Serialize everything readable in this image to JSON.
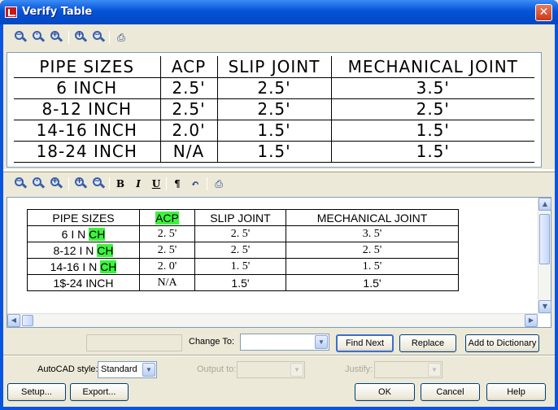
{
  "window": {
    "title": "Verify Table",
    "close_glyph": "✕"
  },
  "toolbar_top": {
    "icons": [
      "zoom-out-icon",
      "zoom-extents-icon",
      "zoom-in-icon",
      "zoom-in-plus-icon",
      "zoom-out-minus-icon",
      "print-icon"
    ]
  },
  "preview_table": {
    "headers": [
      "PIPE SIZES",
      "ACP",
      "SLIP JOINT",
      "MECHANICAL JOINT"
    ],
    "rows": [
      [
        "6 INCH",
        "2.5'",
        "2.5'",
        "3.5'"
      ],
      [
        "8-12 INCH",
        "2.5'",
        "2.5'",
        "2.5'"
      ],
      [
        "14-16 INCH",
        "2.0'",
        "1.5'",
        "1.5'"
      ],
      [
        "18-24 INCH",
        "N/A",
        "1.5'",
        "1.5'"
      ]
    ]
  },
  "toolbar_bottom": {
    "bold": "B",
    "italic": "I",
    "underline": "U",
    "paragraph": "¶",
    "undo": "↶"
  },
  "editor_table": {
    "headers": [
      "PIPE SIZES",
      "ACP",
      "SLIP JOINT",
      "MECHANICAL JOINT"
    ],
    "rows": [
      [
        "6 I N ",
        "CH",
        "2. 5'",
        "2. 5'",
        "3. 5'"
      ],
      [
        "8-12 I N ",
        "CH",
        "2. 5'",
        "2. 5'",
        "2. 5'"
      ],
      [
        "14-16 I N ",
        "CH",
        "2. 0'",
        "1. 5'",
        "1. 5'"
      ],
      [
        "1$-24 INCH",
        "",
        "N/A",
        "1.5'",
        "1.5'"
      ]
    ]
  },
  "spell": {
    "word_value": "",
    "change_to_label": "Change To:",
    "change_to_value": "",
    "find_next": "Find Next",
    "replace": "Replace",
    "add_to_dictionary": "Add to Dictionary"
  },
  "options": {
    "autocad_style_label": "AutoCAD style:",
    "autocad_style_value": "Standard",
    "output_to_label": "Output to:",
    "justify_label": "Justify:"
  },
  "footer": {
    "setup": "Setup...",
    "export": "Export...",
    "ok": "OK",
    "cancel": "Cancel",
    "help": "Help"
  },
  "colors": {
    "highlight": "#3df43d",
    "titlebar": "#0553d8"
  }
}
